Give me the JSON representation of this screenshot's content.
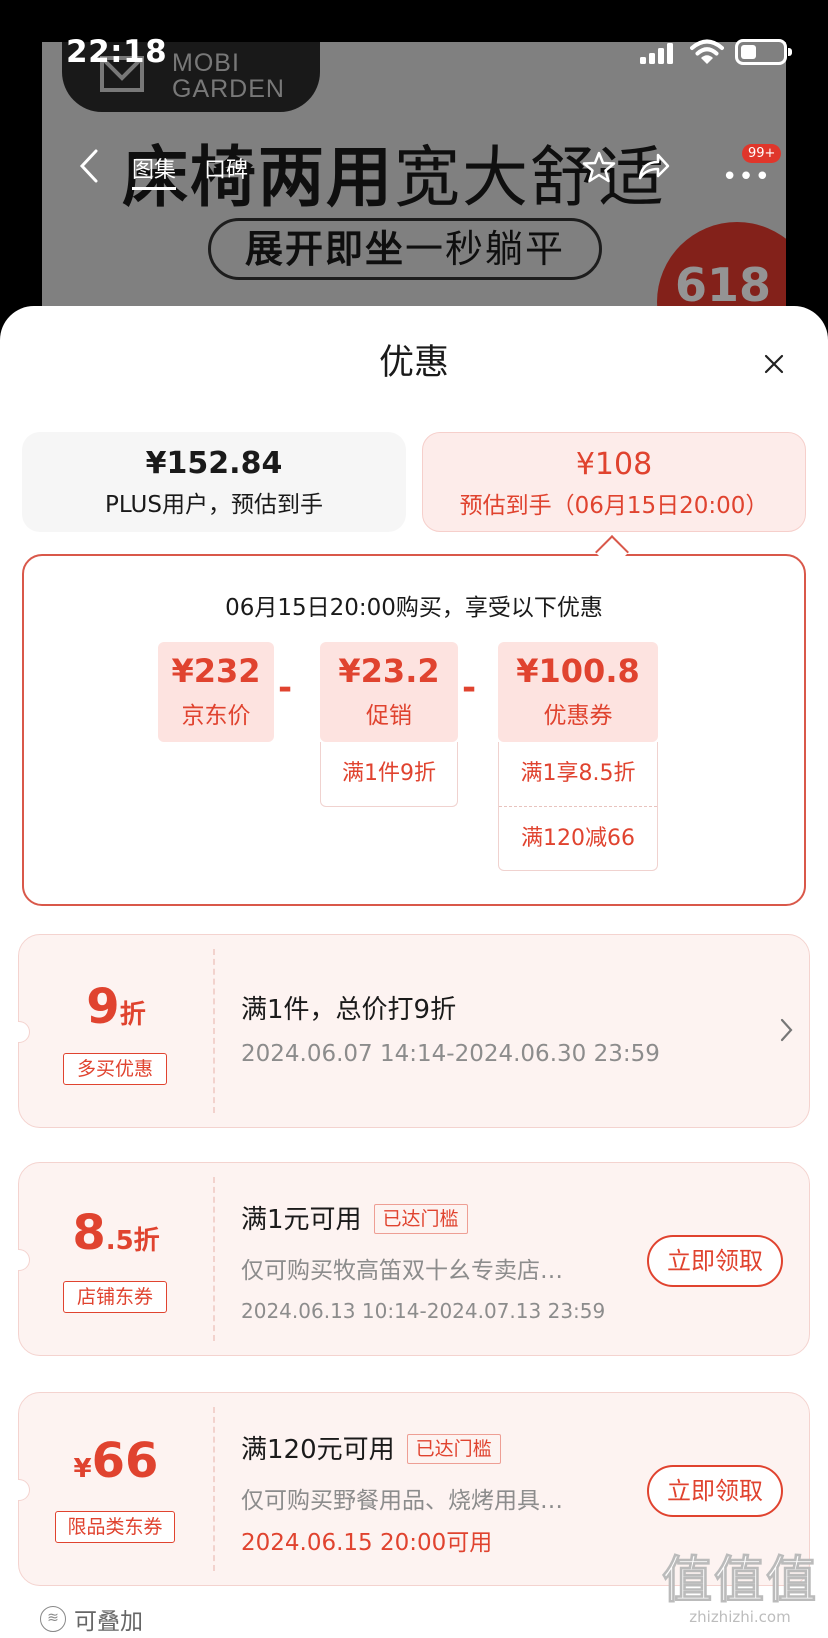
{
  "status_bar": {
    "time": "22:18"
  },
  "banner": {
    "brand_line1": "MOBI",
    "brand_line2": "GARDEN",
    "headline_bold": "床椅两用",
    "headline_thin": "宽大舒适",
    "sub_bold": "展开即坐",
    "sub_thin": "一秒躺平",
    "badge": "618",
    "nav_tabs": [
      "图集",
      "口碑"
    ],
    "msg_count": "99+"
  },
  "sheet": {
    "title": "优惠",
    "price_tabs": [
      {
        "amount": "¥152.84",
        "desc": "PLUS用户，预估到手"
      },
      {
        "amount": "¥108",
        "desc": "预估到手（06月15日20:00）"
      }
    ],
    "breakdown": {
      "title": "06月15日20:00购买，享受以下优惠",
      "items": [
        {
          "value": "¥232",
          "label": "京东价"
        },
        {
          "value": "¥23.2",
          "label": "促销",
          "subs": [
            "满1件9折"
          ]
        },
        {
          "value": "¥100.8",
          "label": "优惠券",
          "subs": [
            "满1享8.5折",
            "满120减66"
          ]
        }
      ],
      "minus": "-"
    },
    "promos": [
      {
        "big_num": "9",
        "big_suffix": "折",
        "tag": "多买优惠",
        "title": "满1件，总价打9折",
        "date": "2024.06.07 14:14-2024.06.30 23:59"
      },
      {
        "big_num": "8",
        "big_suffix": ".5折",
        "tag": "店铺东券",
        "title": "满1元可用",
        "reached": "已达门槛",
        "desc": "仅可购买牧高笛双十幺专卖店…",
        "date": "2024.06.13 10:14-2024.07.13 23:59",
        "button": "立即领取"
      },
      {
        "big_prefix": "¥",
        "big_num": "66",
        "tag": "限品类东券",
        "title": "满120元可用",
        "reached": "已达门槛",
        "desc": "仅可购买野餐用品、烧烤用具…",
        "date": "2024.06.15 20:00可用",
        "button": "立即领取"
      }
    ],
    "stack_hint": "可叠加"
  },
  "watermark": {
    "big": "值值值",
    "small": "zhizhizhi.com"
  },
  "colors": {
    "accent": "#e0432f",
    "card_bg": "#fdf3f1",
    "tab_bg": "#fdecea"
  },
  "icons": [
    "signal-icon",
    "wifi-icon",
    "battery-icon",
    "back-icon",
    "star-icon",
    "share-icon",
    "more-icon",
    "close-icon",
    "chevron-right-icon",
    "stack-icon"
  ]
}
